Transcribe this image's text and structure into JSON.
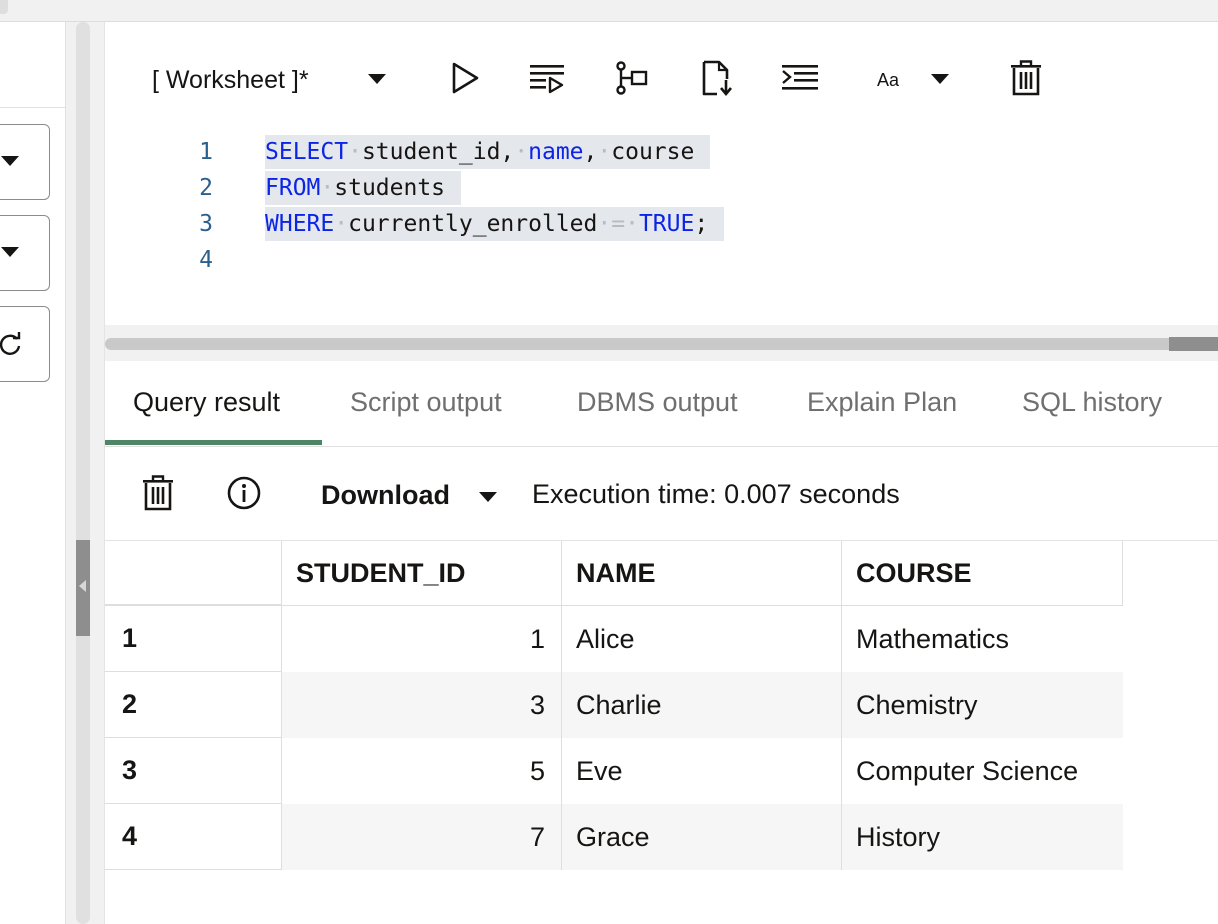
{
  "worksheet": {
    "title": "[ Worksheet ]*",
    "toolbar_icons": [
      "run-statement-icon",
      "run-script-icon",
      "explain-plan-icon",
      "autotrace-icon",
      "format-icon",
      "font-size-icon",
      "clear-icon"
    ],
    "font_label": "Aa"
  },
  "editor": {
    "line_numbers": [
      "1",
      "2",
      "3",
      "4"
    ]
  },
  "tabs": [
    {
      "label": "Query result",
      "active": true
    },
    {
      "label": "Script output",
      "active": false
    },
    {
      "label": "DBMS output",
      "active": false
    },
    {
      "label": "Explain Plan",
      "active": false
    },
    {
      "label": "SQL history",
      "active": false
    }
  ],
  "results_toolbar": {
    "download_label": "Download",
    "execution_time": "Execution time: 0.007 seconds"
  },
  "grid": {
    "columns": [
      "STUDENT_ID",
      "NAME",
      "COURSE"
    ],
    "rows": [
      {
        "row": "1",
        "student_id": "1",
        "name": "Alice",
        "course": "Mathematics"
      },
      {
        "row": "2",
        "student_id": "3",
        "name": "Charlie",
        "course": "Chemistry"
      },
      {
        "row": "3",
        "student_id": "5",
        "name": "Eve",
        "course": "Computer Science"
      },
      {
        "row": "4",
        "student_id": "7",
        "name": "Grace",
        "course": "History"
      }
    ]
  },
  "colors": {
    "keyword": "#0b24e5",
    "active_tab_underline": "#4e8567",
    "selection": "#e4e7ec"
  }
}
